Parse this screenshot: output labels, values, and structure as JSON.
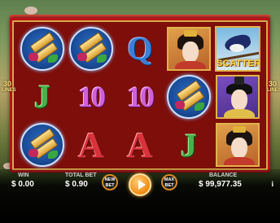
{
  "lines": {
    "left_number": "30",
    "left_word": "LINES",
    "right_number": "30",
    "right_word": "LINES"
  },
  "reels": [
    [
      "gold-coin",
      "J",
      "gold-coin"
    ],
    [
      "gold-coin",
      "10",
      "A"
    ],
    [
      "Q",
      "10",
      "A"
    ],
    [
      "lady-portrait",
      "gold-coin",
      "J"
    ],
    [
      "scatter",
      "lord-portrait",
      "lady-portrait"
    ]
  ],
  "symbols": {
    "Q": "Q",
    "J": "J",
    "10": "10",
    "A": "A",
    "scatter_label": "SCATTER"
  },
  "hud": {
    "win_label": "WIN",
    "win_value": "$ 0.00",
    "total_bet_label": "TOTAL BET",
    "total_bet_value": "$ 0.90",
    "new_bet_top": "NEW",
    "new_bet_bottom": "BET",
    "max_bet_top": "MAX",
    "max_bet_bottom": "BET",
    "balance_label": "BALANCE",
    "balance_value": "$ 99,977.35",
    "info_label": "i"
  },
  "colors": {
    "frame": "#7d0e0a",
    "frame_border": "#b9121a",
    "spin": "#f08a10",
    "lines_text": "#ffe27a"
  }
}
